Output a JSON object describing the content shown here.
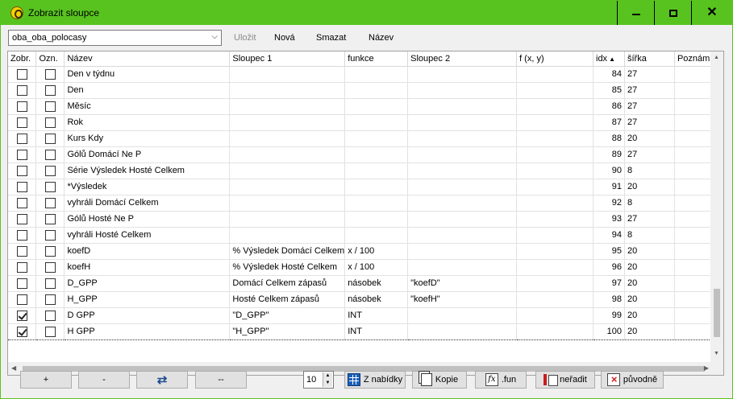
{
  "window": {
    "title": "Zobrazit sloupce",
    "minimize_icon": "minimize-icon",
    "maximize_icon": "maximize-icon",
    "close_glyph": "✕"
  },
  "toolbar": {
    "preset_value": "oba_oba_polocasy",
    "save_label": "Uložit",
    "new_label": "Nová",
    "delete_label": "Smazat",
    "name_label": "Název"
  },
  "grid": {
    "headers": {
      "show": "Zobr.",
      "mark": "Ozn.",
      "name": "Název",
      "col1": "Sloupec 1",
      "func": "funkce",
      "col2": "Sloupec 2",
      "fxy": "f (x, y)",
      "idx": "idx",
      "width": "šířka",
      "note": "Poznámka"
    },
    "sort_glyph": "▲",
    "rows": [
      {
        "name": "Den v týdnu",
        "col1": "",
        "func": "",
        "col2": "",
        "fxy": "",
        "idx": "84",
        "width": "27",
        "show": false,
        "mark": false
      },
      {
        "name": "Den",
        "col1": "",
        "func": "",
        "col2": "",
        "fxy": "",
        "idx": "85",
        "width": "27",
        "show": false,
        "mark": false
      },
      {
        "name": "Měsíc",
        "col1": "",
        "func": "",
        "col2": "",
        "fxy": "",
        "idx": "86",
        "width": "27",
        "show": false,
        "mark": false
      },
      {
        "name": "Rok",
        "col1": "",
        "func": "",
        "col2": "",
        "fxy": "",
        "idx": "87",
        "width": "27",
        "show": false,
        "mark": false
      },
      {
        "name": "Kurs Kdy",
        "col1": "",
        "func": "",
        "col2": "",
        "fxy": "",
        "idx": "88",
        "width": "20",
        "show": false,
        "mark": false
      },
      {
        "name": "Gólů Domácí Ne P",
        "col1": "",
        "func": "",
        "col2": "",
        "fxy": "",
        "idx": "89",
        "width": "27",
        "show": false,
        "mark": false
      },
      {
        "name": "Série Výsledek Hosté Celkem",
        "col1": "",
        "func": "",
        "col2": "",
        "fxy": "",
        "idx": "90",
        "width": "8",
        "show": false,
        "mark": false
      },
      {
        "name": "*Výsledek",
        "col1": "",
        "func": "",
        "col2": "",
        "fxy": "",
        "idx": "91",
        "width": "20",
        "show": false,
        "mark": false
      },
      {
        "name": "vyhráli Domácí Celkem",
        "col1": "",
        "func": "",
        "col2": "",
        "fxy": "",
        "idx": "92",
        "width": "8",
        "show": false,
        "mark": false
      },
      {
        "name": "Gólů Hosté Ne P",
        "col1": "",
        "func": "",
        "col2": "",
        "fxy": "",
        "idx": "93",
        "width": "27",
        "show": false,
        "mark": false
      },
      {
        "name": "vyhráli Hosté Celkem",
        "col1": "",
        "func": "",
        "col2": "",
        "fxy": "",
        "idx": "94",
        "width": "8",
        "show": false,
        "mark": false
      },
      {
        "name": "koefD",
        "col1": "% Výsledek Domácí Celkem",
        "func": "x / 100",
        "col2": "",
        "fxy": "",
        "idx": "95",
        "width": "20",
        "show": false,
        "mark": false
      },
      {
        "name": "koefH",
        "col1": "% Výsledek Hosté Celkem",
        "func": "x / 100",
        "col2": "",
        "fxy": "",
        "idx": "96",
        "width": "20",
        "show": false,
        "mark": false
      },
      {
        "name": "D_GPP",
        "col1": "Domácí Celkem zápasů",
        "func": "násobek",
        "col2": "\"koefD\"",
        "fxy": "",
        "idx": "97",
        "width": "20",
        "show": false,
        "mark": false
      },
      {
        "name": "H_GPP",
        "col1": "Hosté Celkem zápasů",
        "func": "násobek",
        "col2": "\"koefH\"",
        "fxy": "",
        "idx": "98",
        "width": "20",
        "show": false,
        "mark": false
      },
      {
        "name": "D GPP",
        "col1": "\"D_GPP\"",
        "func": "INT",
        "col2": "",
        "fxy": "",
        "idx": "99",
        "width": "20",
        "show": true,
        "mark": false
      },
      {
        "name": "H GPP",
        "col1": "\"H_GPP\"",
        "func": "INT",
        "col2": "",
        "fxy": "",
        "idx": "100",
        "width": "20",
        "show": true,
        "mark": false
      }
    ]
  },
  "bottom": {
    "add_label": "+",
    "remove_label": "-",
    "dash_label": "--",
    "spin_value": "10",
    "menu_label": "Z nabídky",
    "copy_label": "Kopie",
    "fun_label": ".fun",
    "unsort_label": "neřadit",
    "original_label": "původně"
  },
  "colors": {
    "titlebar": "#58c31f",
    "client": "#f0f0f0"
  }
}
